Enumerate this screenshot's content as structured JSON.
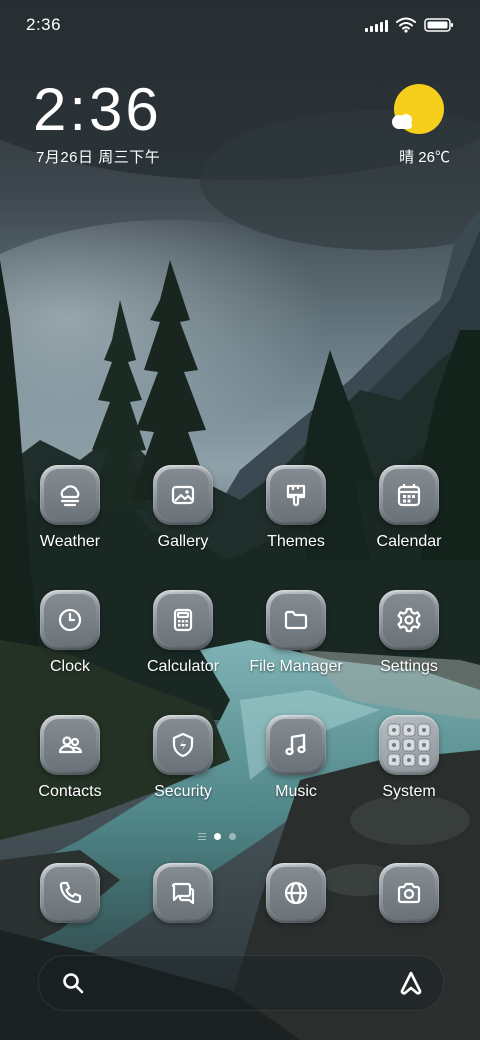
{
  "status_bar": {
    "time": "2:36",
    "icons": [
      "signal-icon",
      "wifi-icon",
      "battery-icon"
    ]
  },
  "clock_widget": {
    "time": "2:36",
    "date": "7月26日 周三下午"
  },
  "weather_widget": {
    "condition_icon": "sunny-icon",
    "text": "晴 26℃",
    "sun_color": "#f6cf1c"
  },
  "apps": [
    {
      "label": "Weather",
      "icon": "weather-icon"
    },
    {
      "label": "Gallery",
      "icon": "gallery-icon"
    },
    {
      "label": "Themes",
      "icon": "themes-brush-icon"
    },
    {
      "label": "Calendar",
      "icon": "calendar-icon"
    },
    {
      "label": "Clock",
      "icon": "clock-icon"
    },
    {
      "label": "Calculator",
      "icon": "calculator-icon"
    },
    {
      "label": "File Manager",
      "icon": "folder-icon"
    },
    {
      "label": "Settings",
      "icon": "gear-icon"
    },
    {
      "label": "Contacts",
      "icon": "contacts-icon"
    },
    {
      "label": "Security",
      "icon": "shield-icon"
    },
    {
      "label": "Music",
      "icon": "music-note-icon"
    },
    {
      "label": "System",
      "icon": "folder-grid-icon"
    }
  ],
  "page_indicator": {
    "pages": 2,
    "current": 1
  },
  "dock": [
    {
      "icon": "phone-icon"
    },
    {
      "icon": "messages-icon"
    },
    {
      "icon": "browser-globe-icon"
    },
    {
      "icon": "camera-icon"
    }
  ],
  "search_bar": {
    "left_icon": "search-icon",
    "right_icon": "assistant-icon"
  }
}
